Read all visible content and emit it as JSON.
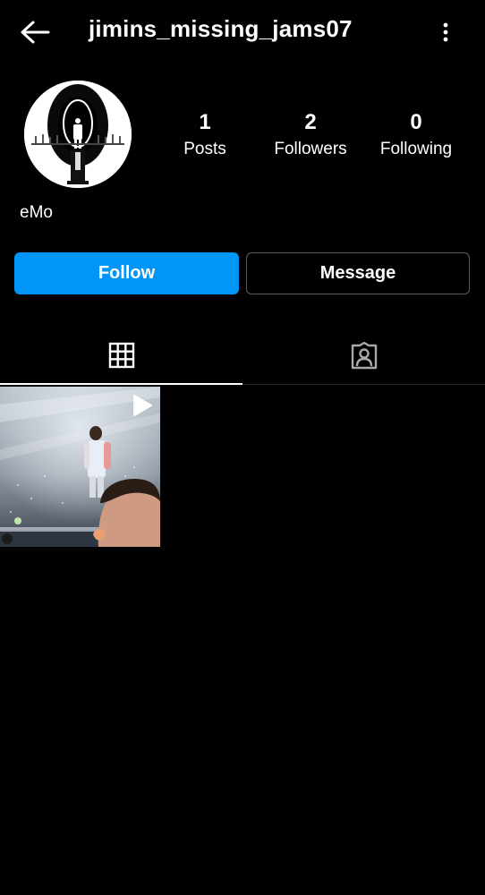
{
  "header": {
    "username": "jimins_missing_jams07",
    "back_icon": "arrow-left-icon",
    "more_icon": "vertical-dots-icon"
  },
  "profile": {
    "display_name": "eMo",
    "stats": [
      {
        "value": "1",
        "label": "Posts"
      },
      {
        "value": "2",
        "label": "Followers"
      },
      {
        "value": "0",
        "label": "Following"
      }
    ]
  },
  "actions": {
    "follow_label": "Follow",
    "message_label": "Message"
  },
  "tabs": [
    {
      "icon": "grid-icon",
      "selected": true
    },
    {
      "icon": "tagged-person-icon",
      "selected": false
    }
  ],
  "posts": [
    {
      "type": "reel",
      "icon": "play-icon"
    }
  ],
  "colors": {
    "background": "#000000",
    "follow_button": "#0095f6",
    "divider": "#262626",
    "text": "#ffffff"
  }
}
